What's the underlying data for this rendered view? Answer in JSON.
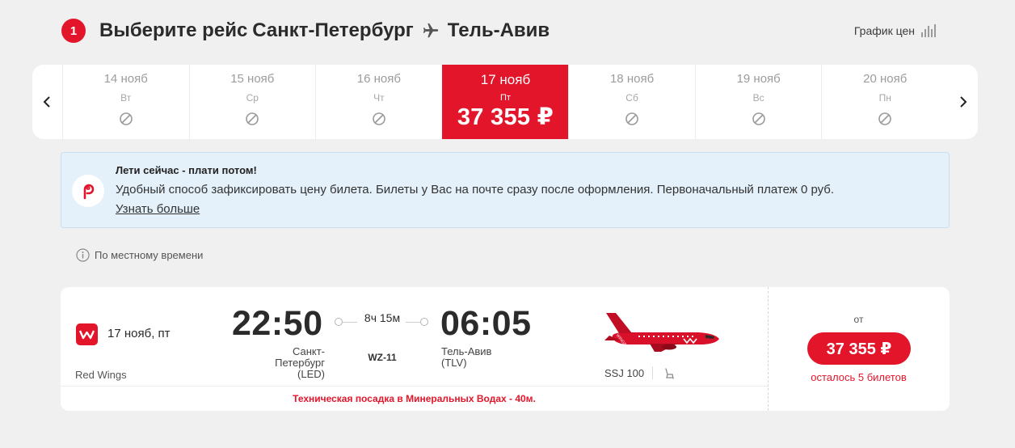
{
  "header": {
    "step_number": "1",
    "title_prefix": "Выберите рейс",
    "origin": "Санкт-Петербург",
    "destination": "Тель-Авив",
    "price_chart_label": "График цен"
  },
  "dates": {
    "prev_arrow": "‹",
    "next_arrow": "›",
    "days": [
      {
        "date": "14 нояб",
        "dow": "Вт"
      },
      {
        "date": "15 нояб",
        "dow": "Ср"
      },
      {
        "date": "16 нояб",
        "dow": "Чт"
      },
      {
        "date": "17 нояб",
        "dow": "Пт",
        "price": "37 355 ₽",
        "selected": true
      },
      {
        "date": "18 нояб",
        "dow": "Сб"
      },
      {
        "date": "19 нояб",
        "dow": "Вс"
      },
      {
        "date": "20 нояб",
        "dow": "Пн"
      }
    ]
  },
  "promo": {
    "title": "Лети сейчас - плати потом!",
    "text": "Удобный способ зафиксировать цену билета. Билеты у Вас на почте сразу после оформления. Первоначальный платеж 0 руб.",
    "link": "Узнать больше"
  },
  "local_time_note": "По местному времени",
  "flight": {
    "date": "17 нояб, пт",
    "airline": "Red Wings",
    "departure_time": "22:50",
    "departure_city": "Санкт-Петербург",
    "departure_code": "(LED)",
    "arrival_time": "06:05",
    "arrival_city": "Тель-Авив",
    "arrival_code": "(TLV)",
    "duration": "8ч 15м",
    "flight_number": "WZ-11",
    "aircraft": "SSJ 100",
    "aircraft_livery_text": "RED WINGS",
    "tech_stop": "Техническая посадка в Минеральных Водах - 40м.",
    "price_from": "от",
    "price": "37 355 ₽",
    "seats_left": "осталось 5 билетов"
  },
  "colors": {
    "accent": "#e3152b",
    "background": "#f0f0f0",
    "promo_bg": "#e4f1fa"
  }
}
